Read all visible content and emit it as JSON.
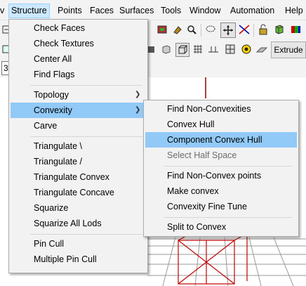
{
  "menubar": {
    "items": [
      {
        "label": "v"
      },
      {
        "label": "Structure"
      },
      {
        "label": "Points"
      },
      {
        "label": "Faces"
      },
      {
        "label": "Surfaces"
      },
      {
        "label": "Tools"
      },
      {
        "label": "Window"
      },
      {
        "label": "Automation"
      },
      {
        "label": "Help"
      }
    ]
  },
  "toolbar": {
    "extrude_label": "Extrude",
    "field_value": "3"
  },
  "structure_menu": {
    "items": [
      {
        "label": "Check Faces"
      },
      {
        "label": "Check Textures"
      },
      {
        "label": "Center All"
      },
      {
        "label": "Find Flags"
      },
      {
        "label": "Topology"
      },
      {
        "label": "Convexity"
      },
      {
        "label": "Carve"
      },
      {
        "label": "Triangulate \\"
      },
      {
        "label": "Triangulate /"
      },
      {
        "label": "Triangulate Convex"
      },
      {
        "label": "Triangulate Concave"
      },
      {
        "label": "Squarize"
      },
      {
        "label": "Squarize All Lods"
      },
      {
        "label": "Pin Cull"
      },
      {
        "label": "Multiple Pin Cull"
      }
    ]
  },
  "convexity_menu": {
    "items": [
      {
        "label": "Find Non-Convexities"
      },
      {
        "label": "Convex Hull"
      },
      {
        "label": "Component Convex Hull"
      },
      {
        "label": "Select Half Space"
      },
      {
        "label": "Find Non-Convex points"
      },
      {
        "label": "Make convex"
      },
      {
        "label": "Convexity Fine Tune"
      },
      {
        "label": "Split to Convex"
      }
    ]
  },
  "colors": {
    "menu_highlight": "#91c9f7",
    "menubar_active": "#cce8ff",
    "wireframe": "#c00000",
    "disabled_text": "#6d6d6d"
  }
}
